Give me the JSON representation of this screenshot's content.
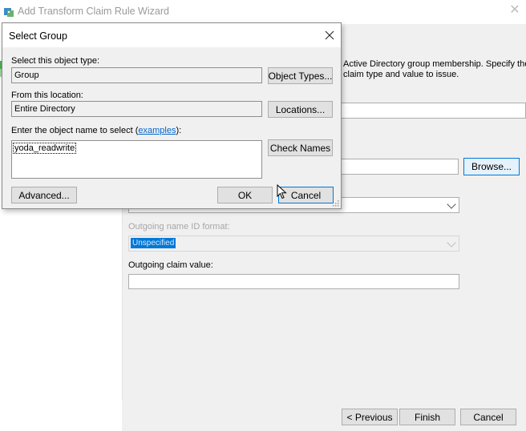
{
  "wizard": {
    "title": "Add Transform Claim Rule Wizard",
    "description_line1": "Active Directory group membership. Specify the",
    "description_line2": "claim type and value to issue.",
    "outgoing_name_id_format_label": "Outgoing name ID format:",
    "outgoing_name_id_format_value": "Unspecified",
    "outgoing_claim_value_label": "Outgoing claim value:",
    "outgoing_claim_value": "",
    "browse_button": "Browse...",
    "footer": {
      "previous_button": "< Previous",
      "finish_button": "Finish",
      "cancel_button": "Cancel"
    }
  },
  "dialog": {
    "title": "Select Group",
    "object_type_label": "Select this object type:",
    "object_type_value": "Group",
    "object_types_button": "Object Types...",
    "location_label": "From this location:",
    "location_value": "Entire Directory",
    "locations_button": "Locations...",
    "object_name_label_prefix": "Enter the object name to select (",
    "examples_link": "examples",
    "object_name_label_suffix": "):",
    "object_name_value": "yoda_readwrite",
    "check_names_button": "Check Names",
    "advanced_button": "Advanced...",
    "ok_button": "OK",
    "cancel_button": "Cancel"
  },
  "icons": {
    "app_icon": "wizard-app-icon",
    "close": "close-icon",
    "dropdown": "chevron-down-icon",
    "cursor": "mouse-pointer-icon"
  },
  "colors": {
    "accent": "#0078d7",
    "link": "#0066cc",
    "dialog_bg": "#f0f0f0",
    "button_bg": "#e1e1e1"
  }
}
